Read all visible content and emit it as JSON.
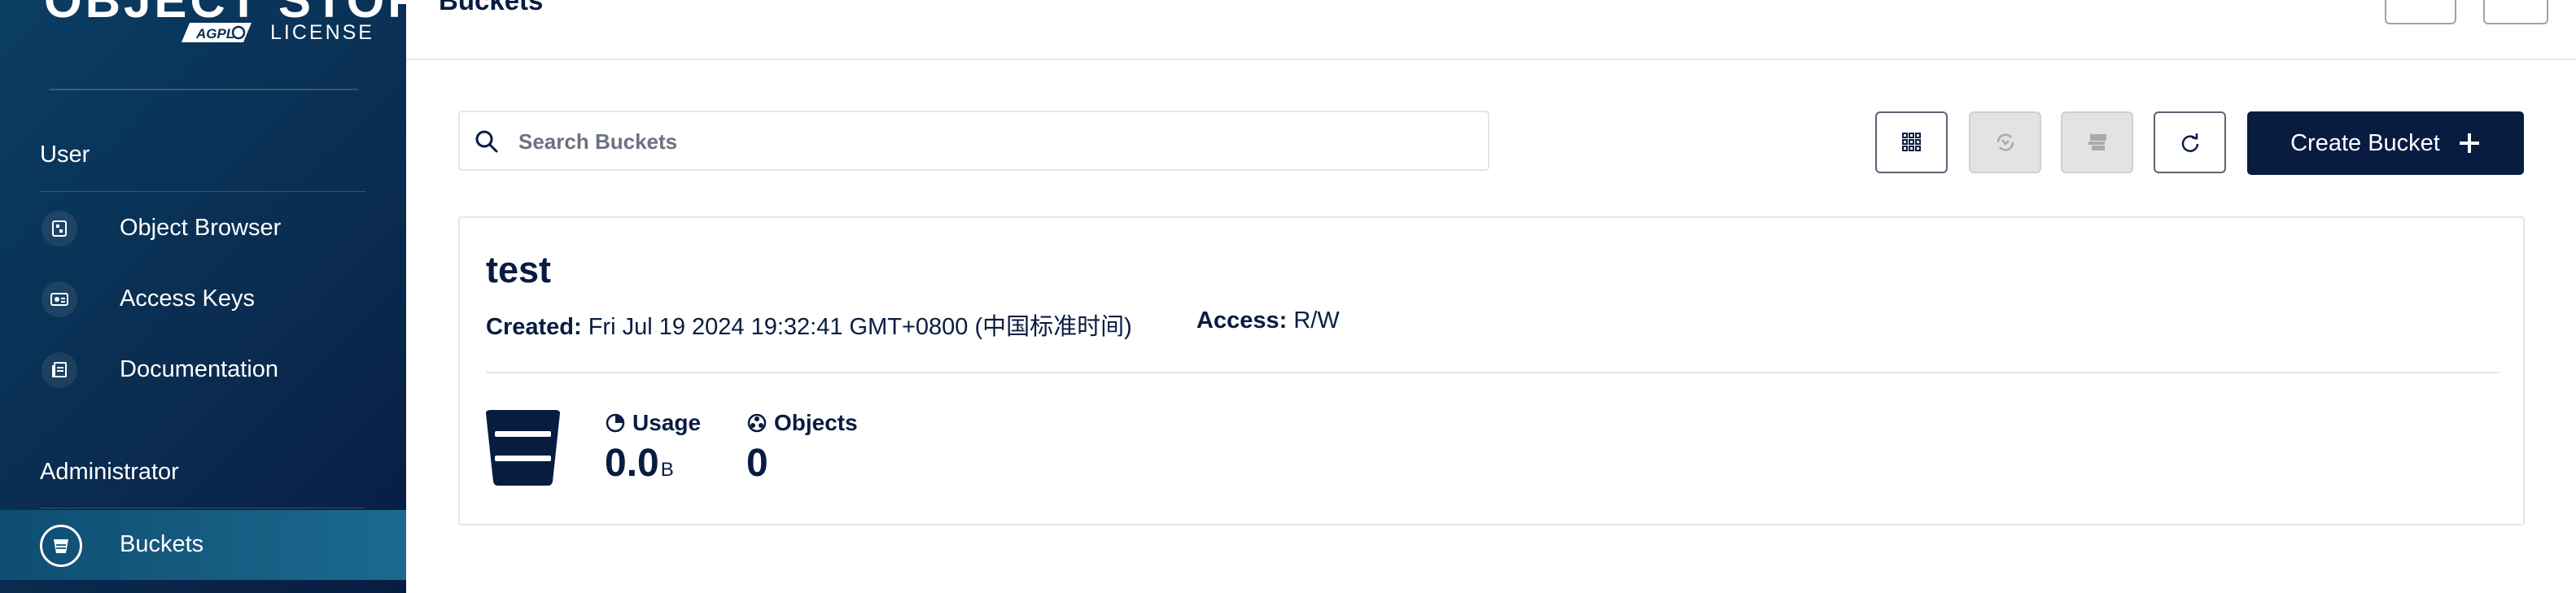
{
  "sidebar": {
    "logo_text": "OBJECT STORE",
    "logo_badge": "AGPL",
    "logo_subtitle": "LICENSE",
    "sections": [
      {
        "title": "User",
        "items": [
          {
            "label": "Object Browser",
            "icon": "object-browser-icon"
          },
          {
            "label": "Access Keys",
            "icon": "access-keys-icon"
          },
          {
            "label": "Documentation",
            "icon": "documentation-icon"
          }
        ]
      },
      {
        "title": "Administrator",
        "items": [
          {
            "label": "Buckets",
            "icon": "bucket-icon",
            "active": true
          }
        ]
      }
    ]
  },
  "header": {
    "title": "Buckets"
  },
  "toolbar": {
    "search_placeholder": "Search Buckets",
    "search_value": "",
    "create_label": "Create Bucket"
  },
  "buckets": [
    {
      "name": "test",
      "created_label": "Created:",
      "created_value": "Fri Jul 19 2024 19:32:41 GMT+0800 (中国标准时间)",
      "access_label": "Access:",
      "access_value": "R/W",
      "usage_label": "Usage",
      "usage_value": "0.0",
      "usage_unit": "B",
      "objects_label": "Objects",
      "objects_value": "0"
    }
  ],
  "colors": {
    "primary": "#081c42",
    "sidebar_active": "#1b6a8e",
    "disabled": "#e3e3e3"
  }
}
